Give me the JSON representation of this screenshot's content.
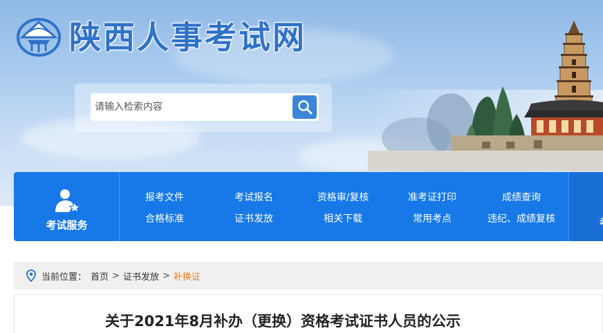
{
  "site": {
    "title": "陕西人事考试网"
  },
  "search": {
    "placeholder": "请输入检索内容",
    "button_icon": "search-icon"
  },
  "nav": {
    "service_label": "考试服务",
    "service_icon": "user-star-icon",
    "row1": [
      "报考文件",
      "考试报名",
      "资格审/复核",
      "准考证打印",
      "成绩查询"
    ],
    "row2": [
      "合格标准",
      "证书发放",
      "相关下载",
      "常用考点",
      "违纪、成绩复核"
    ],
    "right_partial": "考"
  },
  "breadcrumb": {
    "prefix": "当前位置：",
    "items": [
      "首页",
      "证书发放"
    ],
    "separator": ">",
    "current": "补换证"
  },
  "article": {
    "title": "关于2021年8月补办（更换）资格考试证书人员的公示"
  },
  "colors": {
    "nav_blue": "#1779e8",
    "title_blue": "#2f72c9",
    "breadcrumb_current": "#e8781a"
  }
}
